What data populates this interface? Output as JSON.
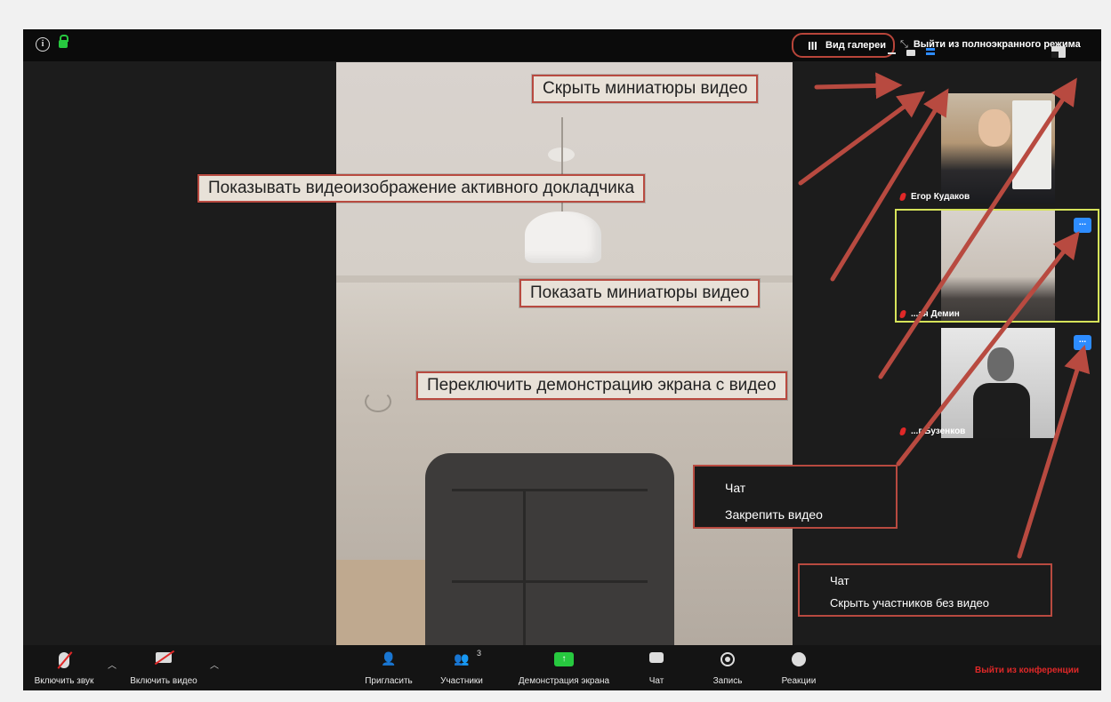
{
  "top_bar": {
    "gallery_view_label": "Вид галереи",
    "exit_fullscreen_label": "Выйти из полноэкранного режима",
    "info_icon": "i"
  },
  "participants": [
    {
      "name": "Егор Кудаков"
    },
    {
      "name": "...ая Демин",
      "more": "..."
    },
    {
      "name": "...г Бузенков",
      "more": "..."
    }
  ],
  "callouts": {
    "hide_thumbnails": "Скрыть миниатюры видео",
    "show_active_speaker": "Показывать видеоизображение активного докладчика",
    "show_thumbnails": "Показать миниатюры видео",
    "switch_share": "Переключить демонстрацию экрана с видео"
  },
  "menu1": {
    "items": [
      "Чат",
      "Закрепить видео"
    ]
  },
  "menu2": {
    "items": [
      "Чат",
      "Скрыть участников без видео"
    ]
  },
  "toolbar": {
    "unmute_label": "Включить звук",
    "start_video_label": "Включить видео",
    "invite_label": "Пригласить",
    "participants_label": "Участники",
    "participants_count": "3",
    "share_label": "Демонстрация экрана",
    "chat_label": "Чат",
    "record_label": "Запись",
    "reactions_label": "Реакции",
    "leave_label": "Выйти из конференции"
  },
  "colors": {
    "accent_blue": "#2d8cff",
    "danger_red": "#e02828",
    "share_green": "#27c93f",
    "annotation_red": "#b84a40"
  }
}
